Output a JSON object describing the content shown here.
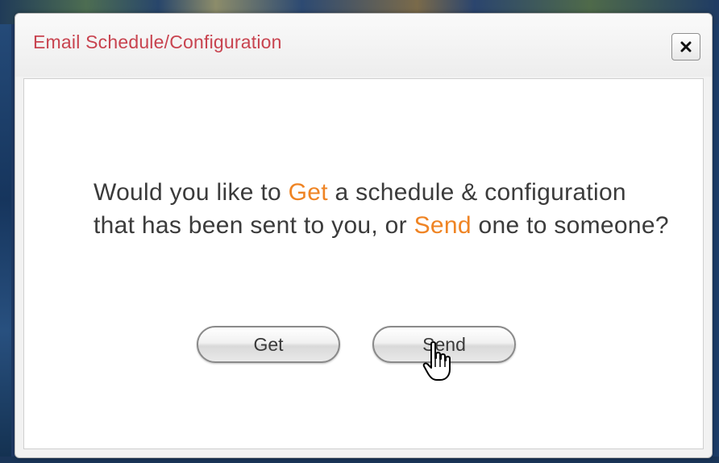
{
  "dialog": {
    "title": "Email Schedule/Configuration",
    "close_label": "close"
  },
  "message": {
    "part1": "Would you like to ",
    "get_word": "Get",
    "part2": " a schedule & configuration that has been sent to you, or ",
    "send_word": "Send",
    "part3": " one to someone?"
  },
  "buttons": {
    "get_label": "Get",
    "send_label": "Send"
  },
  "colors": {
    "title": "#c8434f",
    "highlight": "#ef8424",
    "text": "#3b3b3b"
  },
  "icons": {
    "close": "close-icon",
    "cursor": "hand-pointer-icon"
  }
}
